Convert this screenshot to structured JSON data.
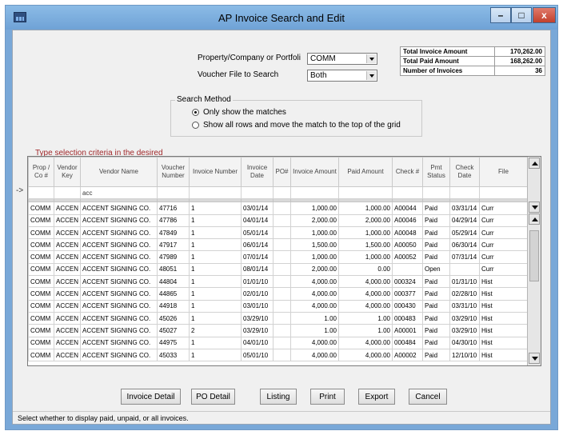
{
  "window": {
    "title": "AP Invoice Search and Edit"
  },
  "form": {
    "property_label": "Property/Company or Portfoli",
    "property_value": "COMM",
    "voucher_label": "Voucher File to Search",
    "voucher_value": "Both"
  },
  "totals": {
    "invoice_label": "Total Invoice Amount",
    "invoice_value": "170,262.00",
    "paid_label": "Total Paid Amount",
    "paid_value": "168,262.00",
    "count_label": "Number of Invoices",
    "count_value": "36"
  },
  "search_method": {
    "title": "Search Method",
    "option1": "Only show the matches",
    "option2": "Show all rows and move the match to the top of the grid",
    "selected": 1
  },
  "grid": {
    "hint": "Type selection criteria in the desired",
    "row_marker": "->",
    "headers": [
      "Prop / Co #",
      "Vendor Key",
      "Vendor Name",
      "Voucher Number",
      "Invoice Number",
      "Invoice Date",
      "PO#",
      "Invoice Amount",
      "Paid Amount",
      "Check #",
      "Pmt Status",
      "Check Date",
      "File"
    ],
    "filter": [
      "",
      "",
      "acc",
      "",
      "",
      "",
      "",
      "",
      "",
      "",
      "",
      "",
      ""
    ],
    "rows": [
      [
        "COMM",
        "ACCEN",
        "ACCENT SIGNING CO.",
        "47716",
        "1",
        "03/01/14",
        "",
        "1,000.00",
        "1,000.00",
        "A00044",
        "Paid",
        "03/31/14",
        "Curr"
      ],
      [
        "COMM",
        "ACCEN",
        "ACCENT SIGNING CO.",
        "47786",
        "1",
        "04/01/14",
        "",
        "2,000.00",
        "2,000.00",
        "A00046",
        "Paid",
        "04/29/14",
        "Curr"
      ],
      [
        "COMM",
        "ACCEN",
        "ACCENT SIGNING CO.",
        "47849",
        "1",
        "05/01/14",
        "",
        "1,000.00",
        "1,000.00",
        "A00048",
        "Paid",
        "05/29/14",
        "Curr"
      ],
      [
        "COMM",
        "ACCEN",
        "ACCENT SIGNING CO.",
        "47917",
        "1",
        "06/01/14",
        "",
        "1,500.00",
        "1,500.00",
        "A00050",
        "Paid",
        "06/30/14",
        "Curr"
      ],
      [
        "COMM",
        "ACCEN",
        "ACCENT SIGNING CO.",
        "47989",
        "1",
        "07/01/14",
        "",
        "1,000.00",
        "1,000.00",
        "A00052",
        "Paid",
        "07/31/14",
        "Curr"
      ],
      [
        "COMM",
        "ACCEN",
        "ACCENT SIGNING CO.",
        "48051",
        "1",
        "08/01/14",
        "",
        "2,000.00",
        "0.00",
        "",
        "Open",
        "",
        "Curr"
      ],
      [
        "COMM",
        "ACCEN",
        "ACCENT SIGNING CO.",
        "44804",
        "1",
        "01/01/10",
        "",
        "4,000.00",
        "4,000.00",
        "000324",
        "Paid",
        "01/31/10",
        "Hist"
      ],
      [
        "COMM",
        "ACCEN",
        "ACCENT SIGNING CO.",
        "44865",
        "1",
        "02/01/10",
        "",
        "4,000.00",
        "4,000.00",
        "000377",
        "Paid",
        "02/28/10",
        "Hist"
      ],
      [
        "COMM",
        "ACCEN",
        "ACCENT SIGNING CO.",
        "44918",
        "1",
        "03/01/10",
        "",
        "4,000.00",
        "4,000.00",
        "000430",
        "Paid",
        "03/31/10",
        "Hist"
      ],
      [
        "COMM",
        "ACCEN",
        "ACCENT SIGNING CO.",
        "45026",
        "1",
        "03/29/10",
        "",
        "1.00",
        "1.00",
        "000483",
        "Paid",
        "03/29/10",
        "Hist"
      ],
      [
        "COMM",
        "ACCEN",
        "ACCENT SIGNING CO.",
        "45027",
        "2",
        "03/29/10",
        "",
        "1.00",
        "1.00",
        "A00001",
        "Paid",
        "03/29/10",
        "Hist"
      ],
      [
        "COMM",
        "ACCEN",
        "ACCENT SIGNING CO.",
        "44975",
        "1",
        "04/01/10",
        "",
        "4,000.00",
        "4,000.00",
        "000484",
        "Paid",
        "04/30/10",
        "Hist"
      ],
      [
        "COMM",
        "ACCEN",
        "ACCENT SIGNING CO.",
        "45033",
        "1",
        "05/01/10",
        "",
        "4,000.00",
        "4,000.00",
        "A00002",
        "Paid",
        "12/10/10",
        "Hist"
      ]
    ]
  },
  "buttons": {
    "invoice_detail": "Invoice Detail",
    "po_detail": "PO Detail",
    "listing": "Listing",
    "print": "Print",
    "export": "Export",
    "cancel": "Cancel"
  },
  "status_bar": "Select whether to display paid, unpaid, or all invoices."
}
